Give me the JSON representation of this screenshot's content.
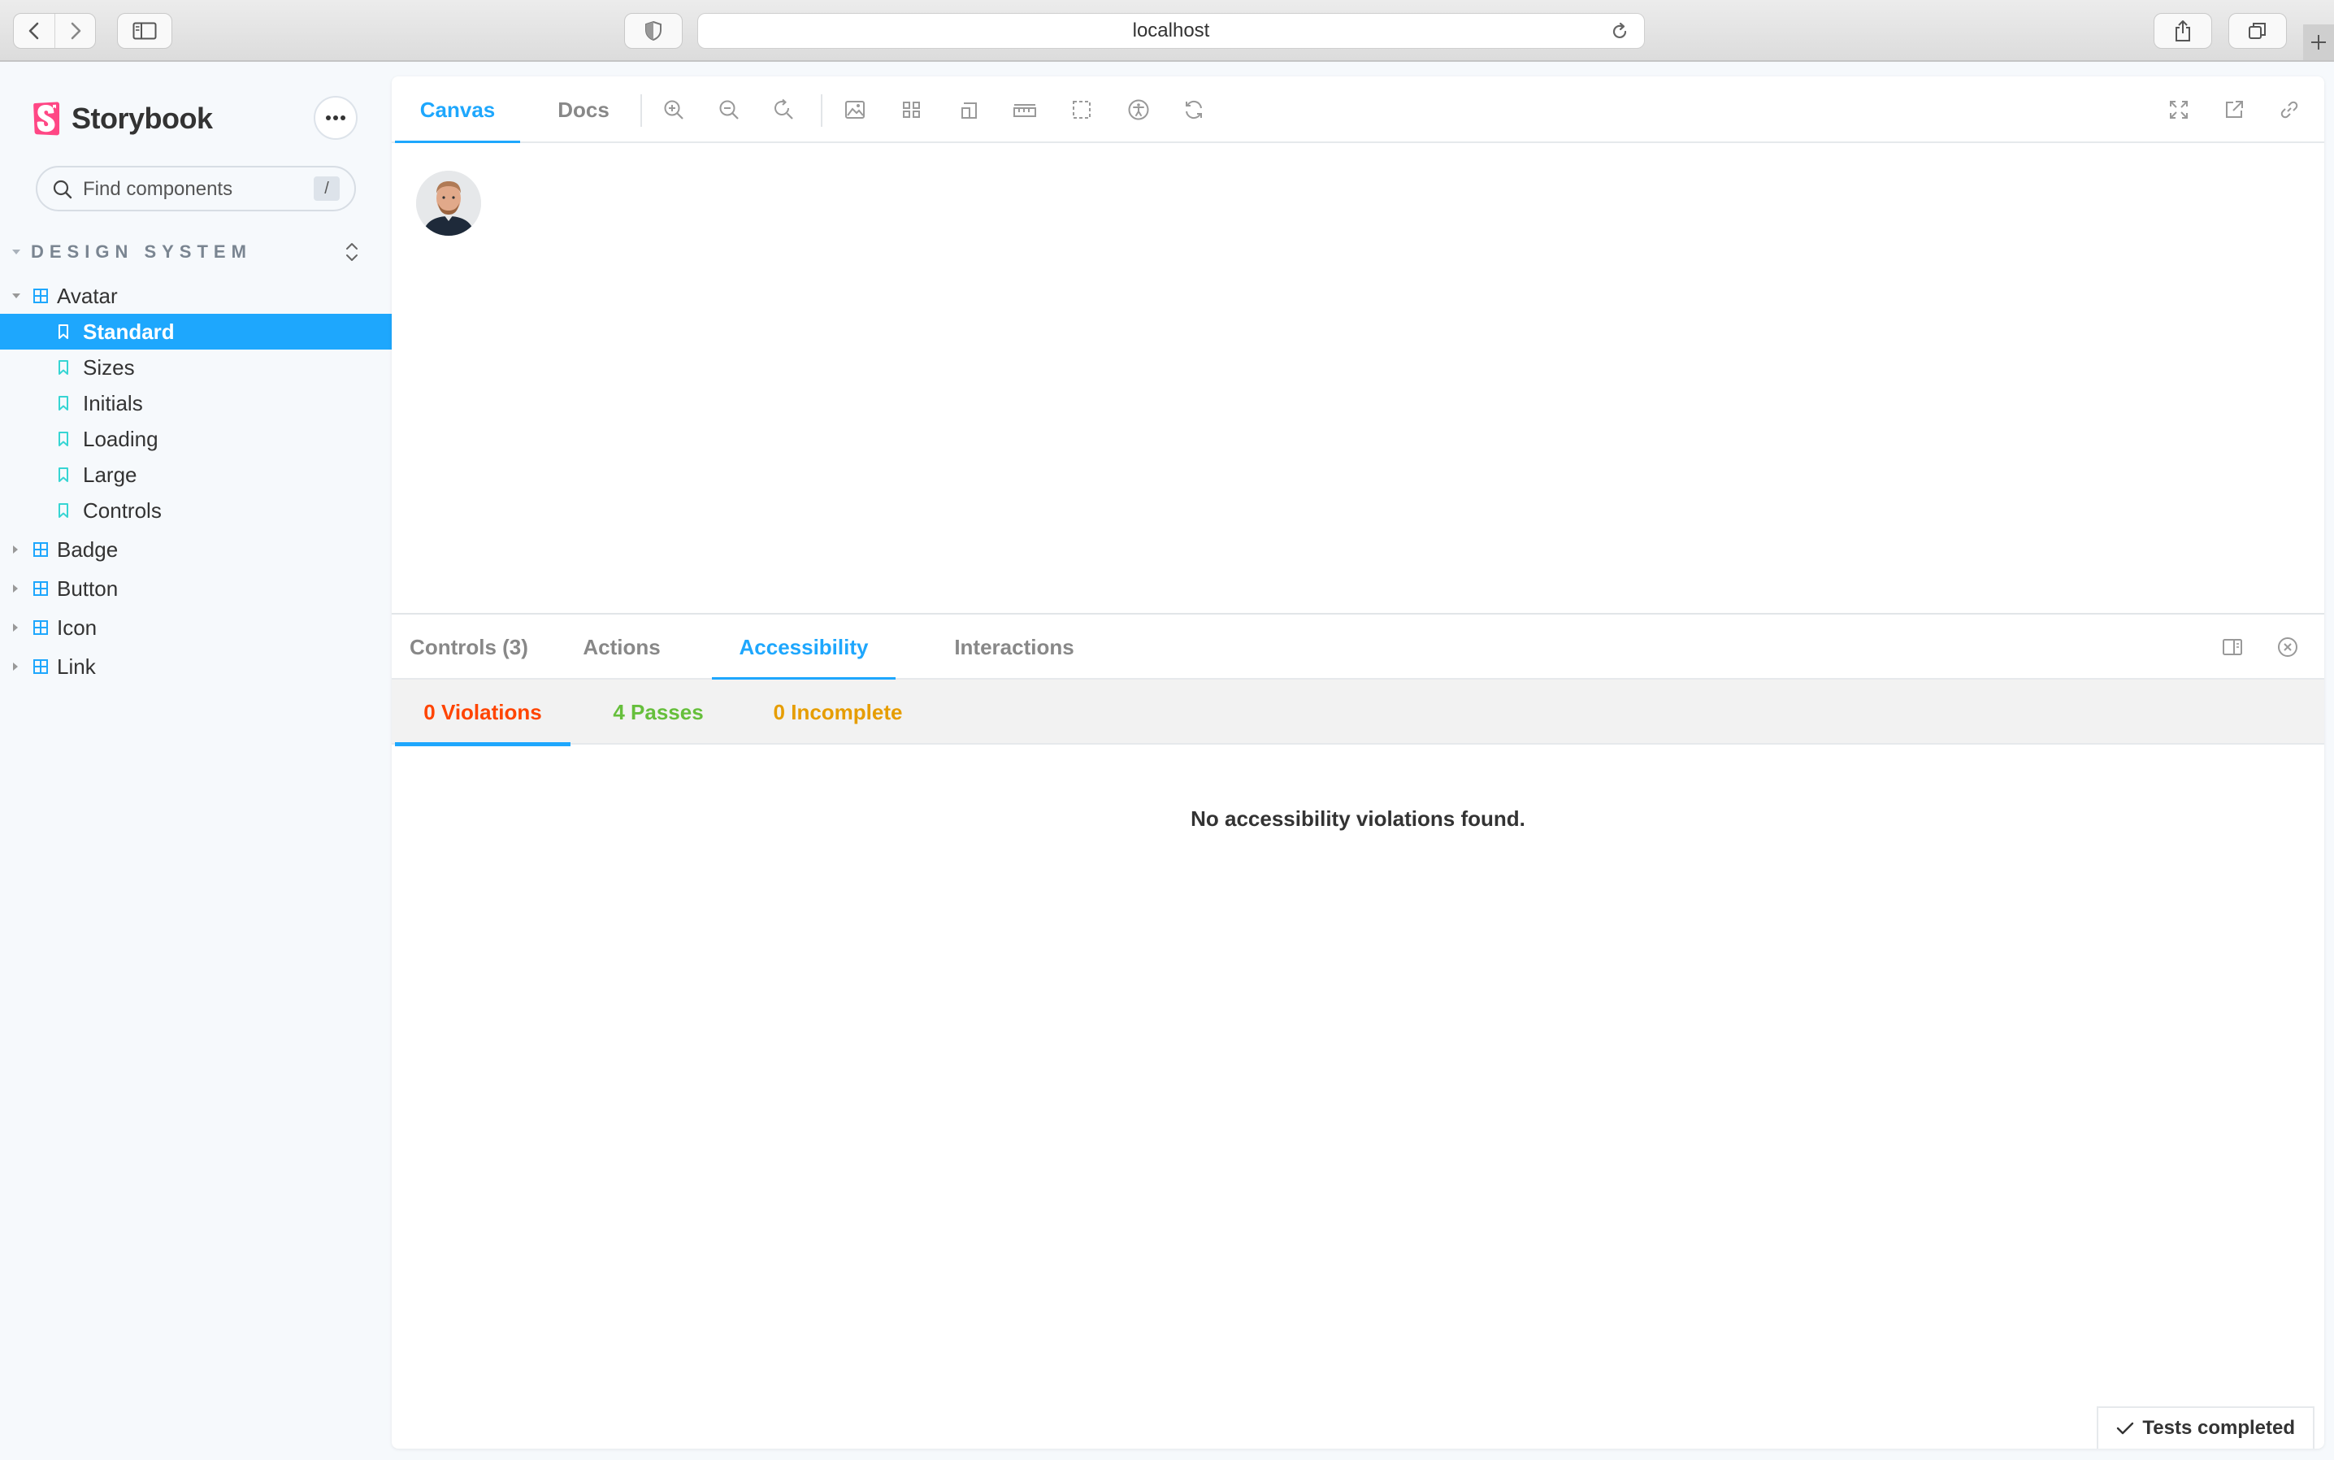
{
  "browser": {
    "url": "localhost",
    "icons": [
      "back-icon",
      "forward-icon",
      "sidebar-icon",
      "shield-icon",
      "reload-icon",
      "share-icon",
      "tabs-icon",
      "plus-icon"
    ]
  },
  "sidebar": {
    "brand": "Storybook",
    "search": {
      "placeholder": "Find components",
      "shortcut": "/"
    },
    "group_title": "DESIGN SYSTEM",
    "tree": [
      {
        "type": "component",
        "label": "Avatar",
        "expanded": true
      },
      {
        "type": "story",
        "label": "Standard",
        "selected": true
      },
      {
        "type": "story",
        "label": "Sizes"
      },
      {
        "type": "story",
        "label": "Initials"
      },
      {
        "type": "story",
        "label": "Loading"
      },
      {
        "type": "story",
        "label": "Large"
      },
      {
        "type": "story",
        "label": "Controls"
      },
      {
        "type": "component",
        "label": "Badge",
        "expanded": false
      },
      {
        "type": "component",
        "label": "Button",
        "expanded": false
      },
      {
        "type": "component",
        "label": "Icon",
        "expanded": false
      },
      {
        "type": "component",
        "label": "Link",
        "expanded": false
      }
    ]
  },
  "toolbar": {
    "tabs": [
      {
        "label": "Canvas",
        "active": true
      },
      {
        "label": "Docs",
        "active": false
      }
    ],
    "tools": [
      "zoom-in-icon",
      "zoom-out-icon",
      "zoom-reset-icon",
      "background-icon",
      "grid-icon",
      "viewport-icon",
      "measure-icon",
      "outline-icon",
      "accessibility-icon",
      "remount-icon"
    ],
    "right_tools": [
      "fullscreen-icon",
      "open-new-tab-icon",
      "copy-link-icon"
    ]
  },
  "addons": {
    "tabs": [
      {
        "label": "Controls (3)",
        "active": false
      },
      {
        "label": "Actions",
        "active": false
      },
      {
        "label": "Accessibility",
        "active": true
      },
      {
        "label": "Interactions",
        "active": false
      }
    ],
    "a11y": {
      "tabs": [
        {
          "label": "0 Violations",
          "color": "#ff4400",
          "active": true
        },
        {
          "label": "4 Passes",
          "color": "#66bf3c",
          "active": false
        },
        {
          "label": "0 Incomplete",
          "color": "#e69d00",
          "active": false
        }
      ],
      "message": "No accessibility violations found.",
      "status": "Tests completed"
    }
  },
  "colors": {
    "accent": "#1ea7fd",
    "brand": "#ff4785",
    "sidebar_bg": "#f6f9fc"
  }
}
